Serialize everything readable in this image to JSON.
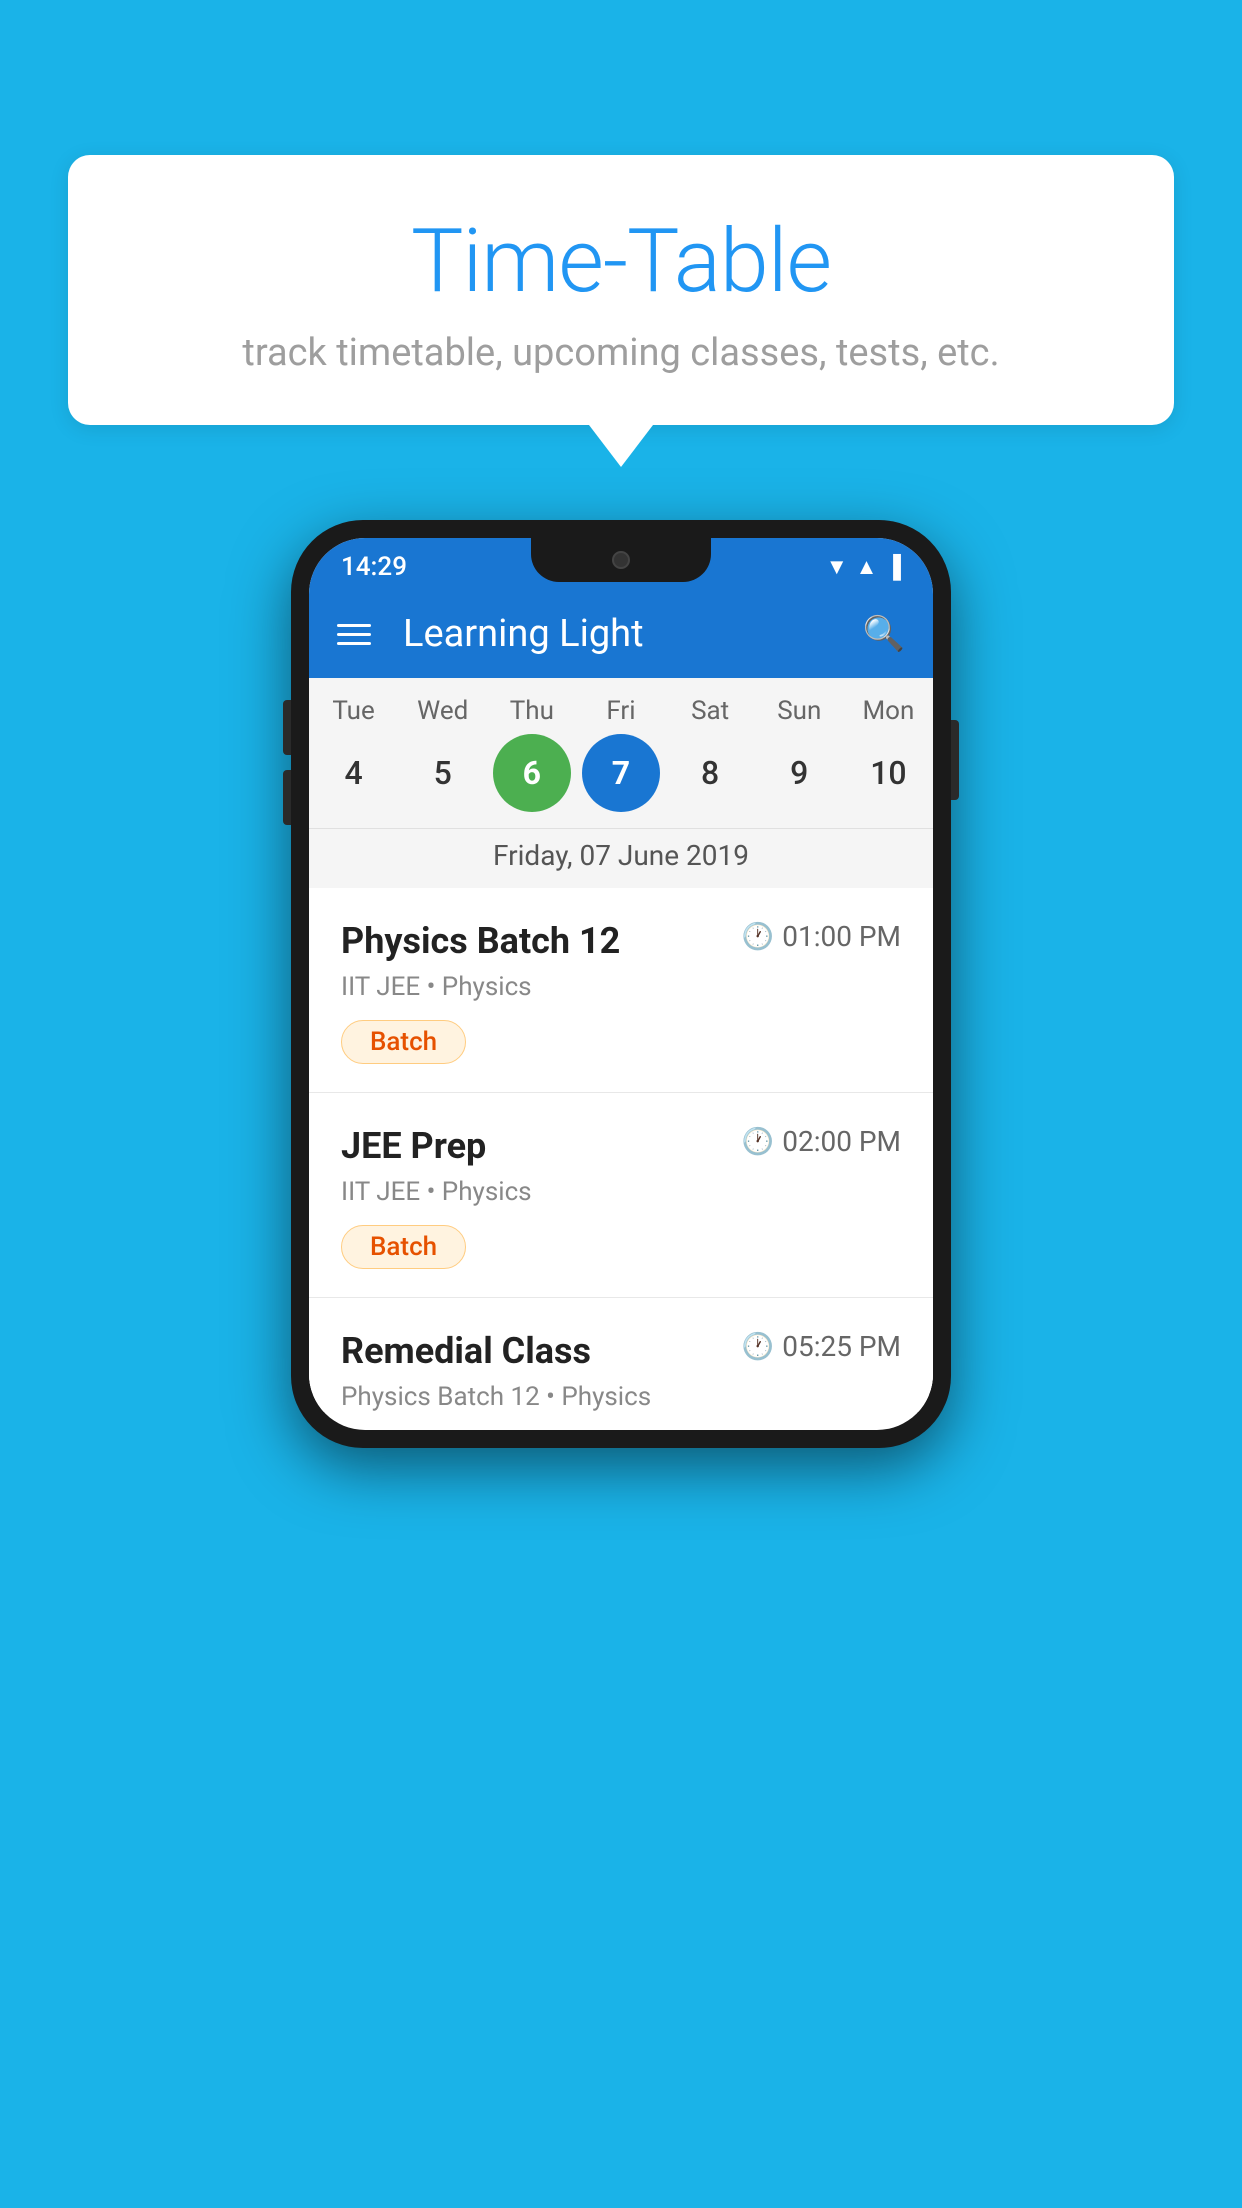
{
  "background_color": "#1ab3e8",
  "speech_bubble": {
    "title": "Time-Table",
    "subtitle": "track timetable, upcoming classes, tests, etc."
  },
  "phone": {
    "status_bar": {
      "time": "14:29"
    },
    "app_bar": {
      "title": "Learning Light"
    },
    "calendar": {
      "days": [
        {
          "label": "Tue",
          "number": "4"
        },
        {
          "label": "Wed",
          "number": "5"
        },
        {
          "label": "Thu",
          "number": "6",
          "state": "today"
        },
        {
          "label": "Fri",
          "number": "7",
          "state": "selected"
        },
        {
          "label": "Sat",
          "number": "8"
        },
        {
          "label": "Sun",
          "number": "9"
        },
        {
          "label": "Mon",
          "number": "10"
        }
      ],
      "selected_date_label": "Friday, 07 June 2019"
    },
    "events": [
      {
        "title": "Physics Batch 12",
        "time": "01:00 PM",
        "subtitle": "IIT JEE • Physics",
        "badge": "Batch"
      },
      {
        "title": "JEE Prep",
        "time": "02:00 PM",
        "subtitle": "IIT JEE • Physics",
        "badge": "Batch"
      },
      {
        "title": "Remedial Class",
        "time": "05:25 PM",
        "subtitle": "Physics Batch 12 • Physics",
        "badge": null
      }
    ]
  }
}
